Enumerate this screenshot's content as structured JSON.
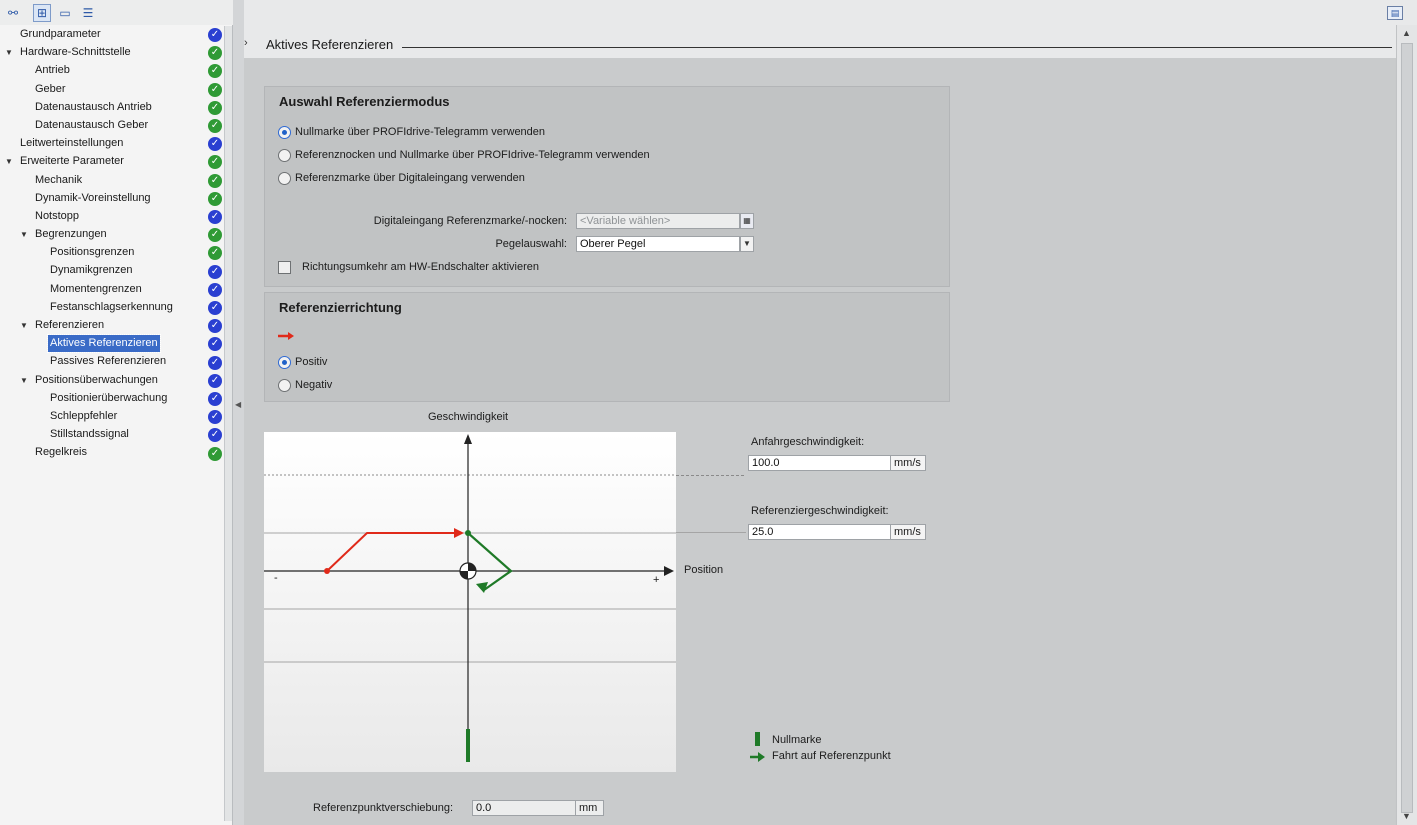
{
  "toolbar": {
    "icons": [
      "device-view-icon",
      "parameter-view-icon",
      "folder-icon",
      "list-icon"
    ]
  },
  "tree": [
    {
      "label": "Grundparameter",
      "level": 0,
      "expander": "",
      "status": "info"
    },
    {
      "label": "Hardware-Schnittstelle",
      "level": 0,
      "expander": "▼",
      "status": "ok"
    },
    {
      "label": "Antrieb",
      "level": 1,
      "expander": "",
      "status": "ok"
    },
    {
      "label": "Geber",
      "level": 1,
      "expander": "",
      "status": "ok"
    },
    {
      "label": "Datenaustausch Antrieb",
      "level": 1,
      "expander": "",
      "status": "ok"
    },
    {
      "label": "Datenaustausch Geber",
      "level": 1,
      "expander": "",
      "status": "ok"
    },
    {
      "label": "Leitwerteinstellungen",
      "level": 0,
      "expander": "",
      "status": "info"
    },
    {
      "label": "Erweiterte Parameter",
      "level": 0,
      "expander": "▼",
      "status": "ok"
    },
    {
      "label": "Mechanik",
      "level": 1,
      "expander": "",
      "status": "ok"
    },
    {
      "label": "Dynamik-Voreinstellung",
      "level": 1,
      "expander": "",
      "status": "ok"
    },
    {
      "label": "Notstopp",
      "level": 1,
      "expander": "",
      "status": "info"
    },
    {
      "label": "Begrenzungen",
      "level": 1,
      "expander": "▼",
      "status": "ok"
    },
    {
      "label": "Positionsgrenzen",
      "level": 2,
      "expander": "",
      "status": "ok"
    },
    {
      "label": "Dynamikgrenzen",
      "level": 2,
      "expander": "",
      "status": "info"
    },
    {
      "label": "Momentengrenzen",
      "level": 2,
      "expander": "",
      "status": "info"
    },
    {
      "label": "Festanschlagserkennung",
      "level": 2,
      "expander": "",
      "status": "info"
    },
    {
      "label": "Referenzieren",
      "level": 1,
      "expander": "▼",
      "status": "info"
    },
    {
      "label": "Aktives Referenzieren",
      "level": 2,
      "expander": "",
      "status": "info",
      "selected": true
    },
    {
      "label": "Passives Referenzieren",
      "level": 2,
      "expander": "",
      "status": "info"
    },
    {
      "label": "Positionsüberwachungen",
      "level": 1,
      "expander": "▼",
      "status": "info"
    },
    {
      "label": "Positionierüberwachung",
      "level": 2,
      "expander": "",
      "status": "info"
    },
    {
      "label": "Schleppfehler",
      "level": 2,
      "expander": "",
      "status": "info"
    },
    {
      "label": "Stillstandssignal",
      "level": 2,
      "expander": "",
      "status": "info"
    },
    {
      "label": "Regelkreis",
      "level": 1,
      "expander": "",
      "status": "ok"
    }
  ],
  "header": {
    "chevron": "›",
    "title": "Aktives Referenzieren"
  },
  "mode_group": {
    "title": "Auswahl Referenziermodus",
    "options": [
      {
        "label": "Nullmarke über PROFIdrive-Telegramm verwenden",
        "checked": true
      },
      {
        "label": "Referenznocken und Nullmarke über PROFIdrive-Telegramm verwenden",
        "checked": false
      },
      {
        "label": "Referenzmarke über Digitaleingang verwenden",
        "checked": false
      }
    ],
    "digital_input_label": "Digitaleingang Referenzmarke/-nocken:",
    "digital_input_placeholder": "<Variable wählen>",
    "level_label": "Pegelauswahl:",
    "level_value": "Oberer Pegel",
    "reverse_label": "Richtungsumkehr am HW-Endschalter aktivieren"
  },
  "direction_group": {
    "title": "Referenzierrichtung",
    "options": [
      {
        "label": "Positiv",
        "checked": true
      },
      {
        "label": "Negativ",
        "checked": false
      }
    ]
  },
  "diagram": {
    "y_axis_label": "Geschwindigkeit",
    "x_axis_label": "Position",
    "minus_sign": "-",
    "plus_sign": "+",
    "approach_speed_label": "Anfahrgeschwindigkeit:",
    "approach_speed_value": "100.0",
    "approach_speed_unit": "mm/s",
    "reference_speed_label": "Referenziergeschwindigkeit:",
    "reference_speed_value": "25.0",
    "reference_speed_unit": "mm/s",
    "legend_zero_mark": "Nullmarke",
    "legend_travel": "Fahrt auf Referenzpunkt",
    "colors": {
      "red": "#e02a1a",
      "green": "#1f7a28"
    }
  },
  "offset": {
    "label": "Referenzpunktverschiebung:",
    "value": "0.0",
    "unit": "mm"
  }
}
